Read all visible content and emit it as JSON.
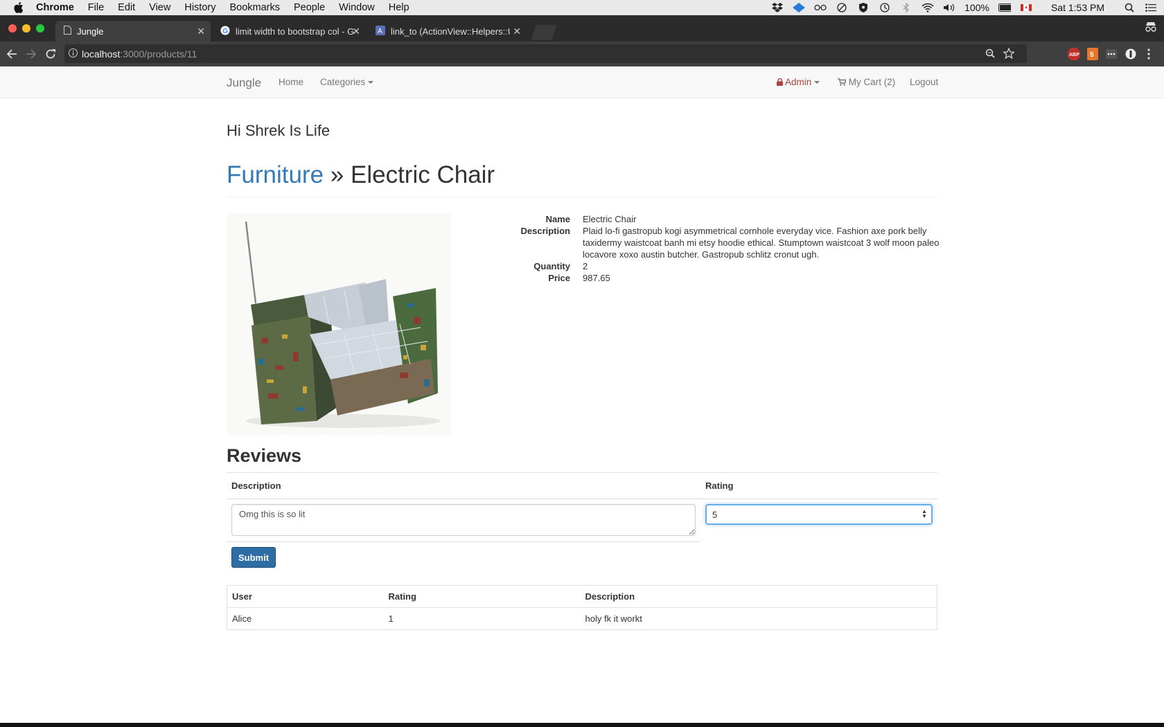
{
  "menubar": {
    "app": "Chrome",
    "items": [
      "File",
      "Edit",
      "View",
      "History",
      "Bookmarks",
      "People",
      "Window",
      "Help"
    ],
    "battery": "100%",
    "clock": "Sat 1:53 PM"
  },
  "tabs": [
    {
      "title": "Jungle",
      "icon": "page-icon"
    },
    {
      "title": "limit width to bootstrap col - G",
      "icon": "google-icon"
    },
    {
      "title": "link_to (ActionView::Helpers::U",
      "icon": "api-icon"
    }
  ],
  "address": {
    "host": "localhost",
    "path": ":3000/products/11"
  },
  "nav": {
    "brand": "Jungle",
    "home": "Home",
    "categories": "Categories",
    "admin": "Admin",
    "cart": "My Cart (2)",
    "logout": "Logout"
  },
  "greeting": "Hi Shrek Is Life",
  "header": {
    "category": "Furniture",
    "separator": " » ",
    "product": "Electric Chair"
  },
  "product": {
    "labels": {
      "name": "Name",
      "description": "Description",
      "quantity": "Quantity",
      "price": "Price"
    },
    "name": "Electric Chair",
    "description": "Plaid lo-fi gastropub kogi asymmetrical cornhole everyday vice. Fashion axe pork belly taxidermy waistcoat banh mi etsy hoodie ethical. Stumptown waistcoat 3 wolf moon paleo locavore xoxo austin butcher. Gastropub schlitz cronut ugh.",
    "quantity": "2",
    "price": "987.65"
  },
  "reviews": {
    "heading": "Reviews",
    "form": {
      "description_header": "Description",
      "rating_header": "Rating",
      "description_value": "Omg this is so lit",
      "rating_value": "5",
      "submit": "Submit"
    },
    "table": {
      "headers": [
        "User",
        "Rating",
        "Description"
      ],
      "rows": [
        {
          "user": "Alice",
          "rating": "1",
          "description": "holy fk it workt"
        }
      ]
    }
  },
  "colors": {
    "link": "#337ab7",
    "admin": "#a94442",
    "button": "#2e6da4"
  }
}
